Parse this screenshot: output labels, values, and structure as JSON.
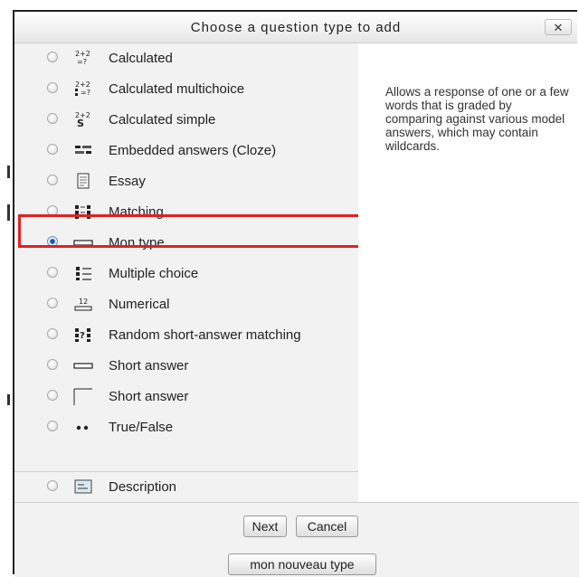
{
  "dialog": {
    "title": "Choose a question type to add",
    "close_label": "✕"
  },
  "options": [
    {
      "label": "Calculated",
      "icon": "calculated-icon",
      "checked": false
    },
    {
      "label": "Calculated multichoice",
      "icon": "calculated-multichoice-icon",
      "checked": false
    },
    {
      "label": "Calculated simple",
      "icon": "calculated-simple-icon",
      "checked": false
    },
    {
      "label": "Embedded answers (Cloze)",
      "icon": "cloze-icon",
      "checked": false
    },
    {
      "label": "Essay",
      "icon": "essay-icon",
      "checked": false
    },
    {
      "label": "Matching",
      "icon": "matching-icon",
      "checked": false
    },
    {
      "label": "Mon type",
      "icon": "short-answer-icon",
      "checked": true
    },
    {
      "label": "Multiple choice",
      "icon": "multiple-choice-icon",
      "checked": false
    },
    {
      "label": "Numerical",
      "icon": "numerical-icon",
      "checked": false
    },
    {
      "label": "Random short-answer matching",
      "icon": "random-matching-icon",
      "checked": false
    },
    {
      "label": "Short answer",
      "icon": "short-answer-icon",
      "checked": false
    },
    {
      "label": "Short answer",
      "icon": "short-answer-alt-icon",
      "checked": false
    },
    {
      "label": "True/False",
      "icon": "true-false-icon",
      "checked": false
    }
  ],
  "other_options": [
    {
      "label": "Description",
      "icon": "description-icon",
      "checked": false
    }
  ],
  "description": "Allows a response of one or a few words that is graded by comparing against various model answers, which may contain wildcards.",
  "buttons": {
    "next": "Next",
    "cancel": "Cancel",
    "custom": "mon nouveau type"
  },
  "colors": {
    "highlight": "#e02020",
    "selected_radio": "#1d5aa3"
  }
}
